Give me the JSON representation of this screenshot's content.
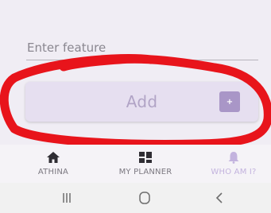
{
  "form": {
    "feature_placeholder": "Enter feature",
    "add_label": "Add",
    "add_icon_glyph": "+"
  },
  "tabs": [
    {
      "label": "ATHINA",
      "icon": "home-icon",
      "active": false
    },
    {
      "label": "MY PLANNER",
      "icon": "planner-icon",
      "active": false
    },
    {
      "label": "WHO AM I?",
      "icon": "bell-person-icon",
      "active": true
    }
  ],
  "system_nav": [
    "recent-apps-icon",
    "home-circle-icon",
    "back-icon"
  ],
  "colors": {
    "background": "#f0edf4",
    "button_bg": "#e6dff0",
    "accent": "#a996c7",
    "annotation": "#e8141b",
    "active_tab": "#c3b3de"
  }
}
